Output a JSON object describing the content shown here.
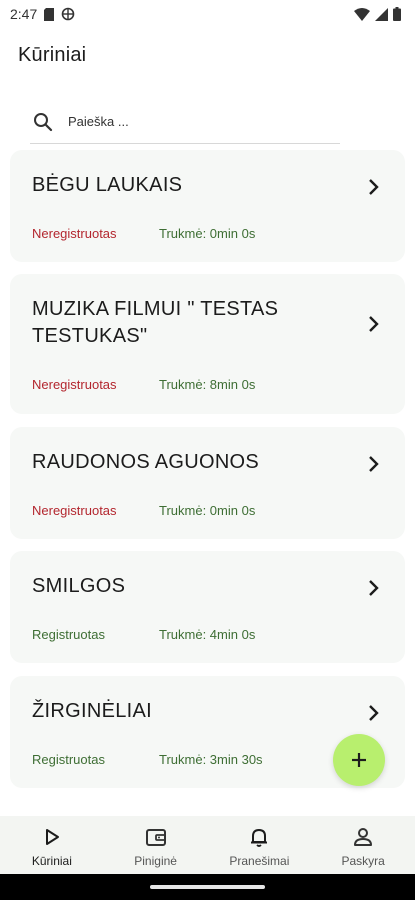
{
  "status_bar": {
    "time": "2:47"
  },
  "app_bar": {
    "title": "Kūriniai"
  },
  "search": {
    "placeholder": "Paieška ..."
  },
  "items": [
    {
      "title": "BĖGU LAUKAIS",
      "status": "Neregistruotas",
      "duration": "Trukmė: 0min 0s"
    },
    {
      "title": "MUZIKA FILMUI \" TESTAS TESTUKAS\"",
      "status": "Neregistruotas",
      "duration": "Trukmė: 8min 0s"
    },
    {
      "title": "RAUDONOS AGUONOS",
      "status": "Neregistruotas",
      "duration": "Trukmė: 0min 0s"
    },
    {
      "title": "SMILGOS",
      "status": "Registruotas",
      "duration": "Trukmė: 4min 0s"
    },
    {
      "title": "ŽIRGINĖLIAI",
      "status": "Registruotas",
      "duration": "Trukmė: 3min 30s"
    }
  ],
  "bottom_nav": {
    "items": [
      {
        "label": "Kūriniai",
        "icon": "play-icon",
        "active": true
      },
      {
        "label": "Piniginė",
        "icon": "wallet-icon",
        "active": false
      },
      {
        "label": "Pranešimai",
        "icon": "bell-icon",
        "active": false
      },
      {
        "label": "Paskyra",
        "icon": "person-icon",
        "active": false
      }
    ]
  },
  "colors": {
    "unregistered": "#b3262e",
    "registered": "#3e6e34",
    "fab": "#b8ef6e",
    "card_bg": "#f6f8f6"
  }
}
